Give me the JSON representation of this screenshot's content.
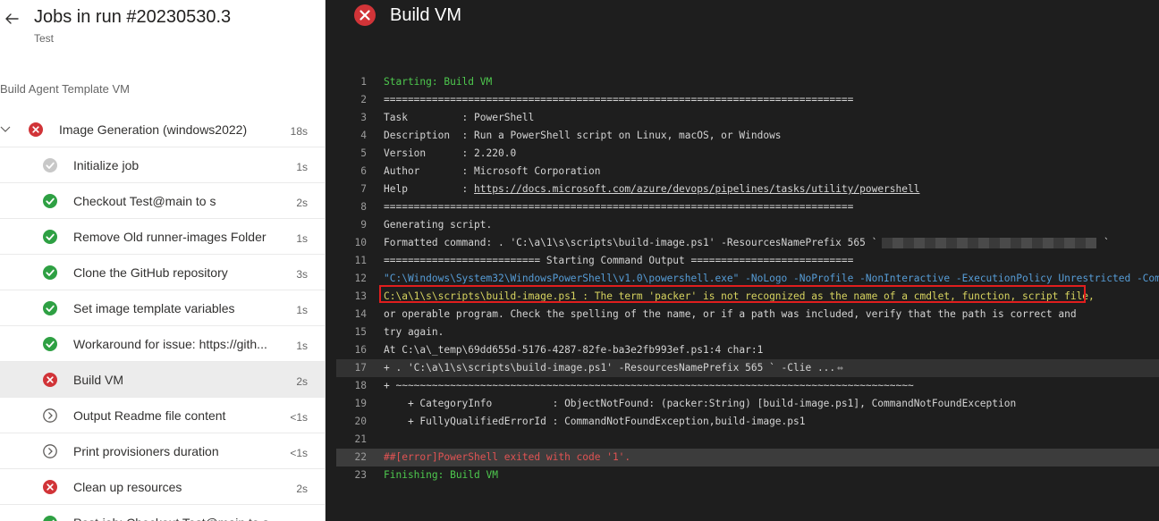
{
  "header": {
    "title": "Jobs in run #20230530.3",
    "subtitle": "Test"
  },
  "stage": {
    "name": "Build Agent Template VM"
  },
  "job": {
    "label": "Image Generation (windows2022)",
    "duration": "18s",
    "status": "failed"
  },
  "steps": [
    {
      "label": "Initialize job",
      "duration": "1s",
      "status": "pending"
    },
    {
      "label": "Checkout Test@main to s",
      "duration": "2s",
      "status": "success"
    },
    {
      "label": "Remove Old runner-images Folder",
      "duration": "1s",
      "status": "success"
    },
    {
      "label": "Clone the GitHub repository",
      "duration": "3s",
      "status": "success"
    },
    {
      "label": "Set image template variables",
      "duration": "1s",
      "status": "success"
    },
    {
      "label": "Workaround for issue: https://gith...",
      "duration": "1s",
      "status": "success"
    },
    {
      "label": "Build VM",
      "duration": "2s",
      "status": "failed"
    },
    {
      "label": "Output Readme file content",
      "duration": "<1s",
      "status": "skipped"
    },
    {
      "label": "Print provisioners duration",
      "duration": "<1s",
      "status": "skipped"
    },
    {
      "label": "Clean up resources",
      "duration": "2s",
      "status": "failed"
    },
    {
      "label": "Post-job: Checkout Test@main to s",
      "duration": "",
      "status": "success"
    }
  ],
  "log": {
    "title": "Build VM",
    "lines": [
      {
        "n": "1",
        "text": "Starting: Build VM"
      },
      {
        "n": "2",
        "text": "=============================================================================="
      },
      {
        "n": "3",
        "text": "Task         : PowerShell"
      },
      {
        "n": "4",
        "text": "Description  : Run a PowerShell script on Linux, macOS, or Windows"
      },
      {
        "n": "5",
        "text": "Version      : 2.220.0"
      },
      {
        "n": "6",
        "text": "Author       : Microsoft Corporation"
      },
      {
        "n": "7",
        "prefix": "Help         : ",
        "link": "https://docs.microsoft.com/azure/devops/pipelines/tasks/utility/powershell"
      },
      {
        "n": "8",
        "text": "=============================================================================="
      },
      {
        "n": "9",
        "text": "Generating script."
      },
      {
        "n": "10",
        "text": "Formatted command: . 'C:\\a\\1\\s\\scripts\\build-image.ps1' -ResourcesNamePrefix 565 ` -ClientId",
        "suffix": "`"
      },
      {
        "n": "11",
        "text": "========================== Starting Command Output ==========================="
      },
      {
        "n": "12",
        "quoted": "\"C:\\Windows\\System32\\WindowsPowerShell\\v1.0\\powershell.exe\"",
        "args": " -NoLogo -NoProfile -NonInteractive -ExecutionPolicy Unrestricted -Command"
      },
      {
        "n": "13",
        "text": "C:\\a\\1\\s\\scripts\\build-image.ps1 : The term 'packer' is not recognized as the name of a cmdlet, function, script file,"
      },
      {
        "n": "14",
        "text": "or operable program. Check the spelling of the name, or if a path was included, verify that the path is correct and"
      },
      {
        "n": "15",
        "text": "try again."
      },
      {
        "n": "16",
        "text": "At C:\\a\\_temp\\69dd655d-5176-4287-82fe-ba3e2fb993ef.ps1:4 char:1"
      },
      {
        "n": "17",
        "text": "+ . 'C:\\a\\1\\s\\scripts\\build-image.ps1' -ResourcesNamePrefix 565 ` -Clie ...",
        "suffix": "⇔"
      },
      {
        "n": "18",
        "text": "+ ~~~~~~~~~~~~~~~~~~~~~~~~~~~~~~~~~~~~~~~~~~~~~~~~~~~~~~~~~~~~~~~~~~~~~~~~~~~~~~~~~~~~~~"
      },
      {
        "n": "19",
        "text": "    + CategoryInfo          : ObjectNotFound: (packer:String) [build-image.ps1], CommandNotFoundException"
      },
      {
        "n": "20",
        "text": "    + FullyQualifiedErrorId : CommandNotFoundException,build-image.ps1"
      },
      {
        "n": "21",
        "text": ""
      },
      {
        "n": "22",
        "text": "##[error]PowerShell exited with code '1'."
      },
      {
        "n": "23",
        "text": "Finishing: Build VM"
      }
    ]
  },
  "colors": {
    "success": "#2ea043",
    "failed": "#d13438",
    "pending": "#c8c8c8",
    "log_green": "#4ec94e",
    "log_yellow": "#d7d35f",
    "log_red": "#e05353",
    "highlight_box": "#e01e1e"
  },
  "icons": {
    "back": "arrow-left-icon",
    "collapse": "chevron-down-icon",
    "success": "check-circle-icon",
    "failed": "x-circle-icon",
    "skipped": "chevron-right-circle-icon",
    "pending": "check-circle-gray-icon"
  }
}
